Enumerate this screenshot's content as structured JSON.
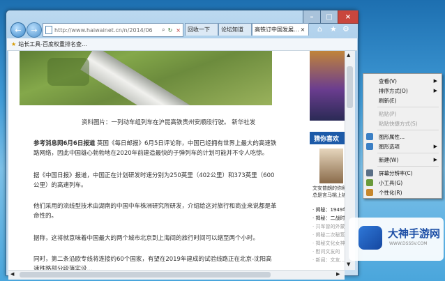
{
  "window": {
    "controls": [
      "–",
      "□",
      "×"
    ]
  },
  "toolbar": {
    "address": "http://www.haiwainet.cn/n/2014/06",
    "tabs": [
      "回收一下",
      "论坛知道",
      "高铁订中国发展..."
    ]
  },
  "favorites": {
    "item": "站长工具-百度权重排名查..."
  },
  "article": {
    "caption": "资料图片：一列动车组列车在沪昆高铁贵州安顺段行驶。 新华社发",
    "para1_lead": "参考消息网6月6日报道",
    "para1": " 英国《每日邮报》6月5日评论称，中国已经拥有世界上最大的高速铁路网络，因此中国雄心勃勃地在2020年前建造最快的子弹列车的计划可能并不令人吃惊。",
    "para2": "据《中国日报》报道，中国正在计划研发时速分别为250英里（402公里）和373英里（600公里）的高速列车。",
    "para3": "他们采用的流线型技术由湖南的中国中车株洲研究所研发，介绍给这对旅行和商业来说都是革命性的。",
    "para4": "据称，这将就意味着中国最大的两个城市北京到上海间的旅行时间可以缩至两个小时。",
    "para5": "同时，第二条沿欧专线将连接约60个国家，有望在2019年建成的试验线路正在北京-沈阳高速铁路部分段落实设..."
  },
  "sidebar": {
    "heading": "猜你喜欢",
    "item_caption": "文安普朗的你和台军",
    "item_caption2": "总是言马桃上被",
    "links": [
      "揭秘：1949年",
      "揭秘：二战时",
      "共军曾的外蒙",
      "揭秘二次秘笈",
      "揭秘文化女神",
      "慰问文友的",
      "新闻：文友..."
    ]
  },
  "context_menu": {
    "items": [
      {
        "label": "查看(V)",
        "arrow": true,
        "disabled": false
      },
      {
        "label": "排序方式(O)",
        "arrow": true,
        "disabled": false
      },
      {
        "label": "刷新(E)",
        "arrow": false,
        "disabled": false
      },
      {
        "label": "粘贴(P)",
        "arrow": false,
        "disabled": true
      },
      {
        "label": "粘贴快捷方式(S)",
        "arrow": false,
        "disabled": true
      },
      {
        "label": "图形属性...",
        "arrow": false,
        "disabled": false
      },
      {
        "label": "图形选项",
        "arrow": true,
        "disabled": false
      },
      {
        "label": "新建(W)",
        "arrow": true,
        "disabled": false
      },
      {
        "label": "屏幕分辨率(C)",
        "arrow": false,
        "disabled": false
      },
      {
        "label": "小工具(G)",
        "arrow": false,
        "disabled": false
      },
      {
        "label": "个性化(R)",
        "arrow": false,
        "disabled": false
      }
    ]
  },
  "watermark": {
    "name": "大神手游网",
    "url": "WWW.DSSSV.COM"
  }
}
